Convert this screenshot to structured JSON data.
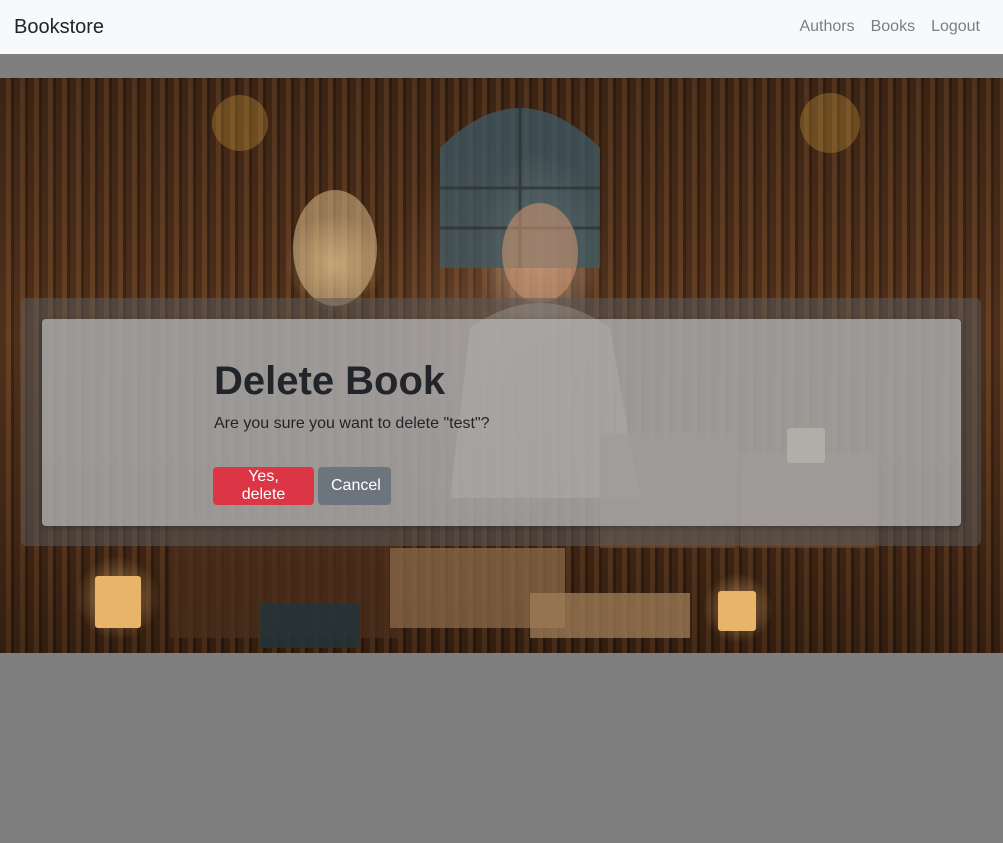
{
  "navbar": {
    "brand": "Bookstore",
    "links": [
      "Authors",
      "Books",
      "Logout"
    ]
  },
  "dialog": {
    "title": "Delete Book",
    "message": "Are you sure you want to delete \"test\"?",
    "confirm_label": "Yes, delete",
    "cancel_label": "Cancel"
  },
  "colors": {
    "danger": "#dc3545",
    "secondary": "#6c757d",
    "navbar_bg": "#f8f9fa",
    "page_bg": "#7f7f7f"
  },
  "hero": {
    "image": "library-background-illustration"
  }
}
